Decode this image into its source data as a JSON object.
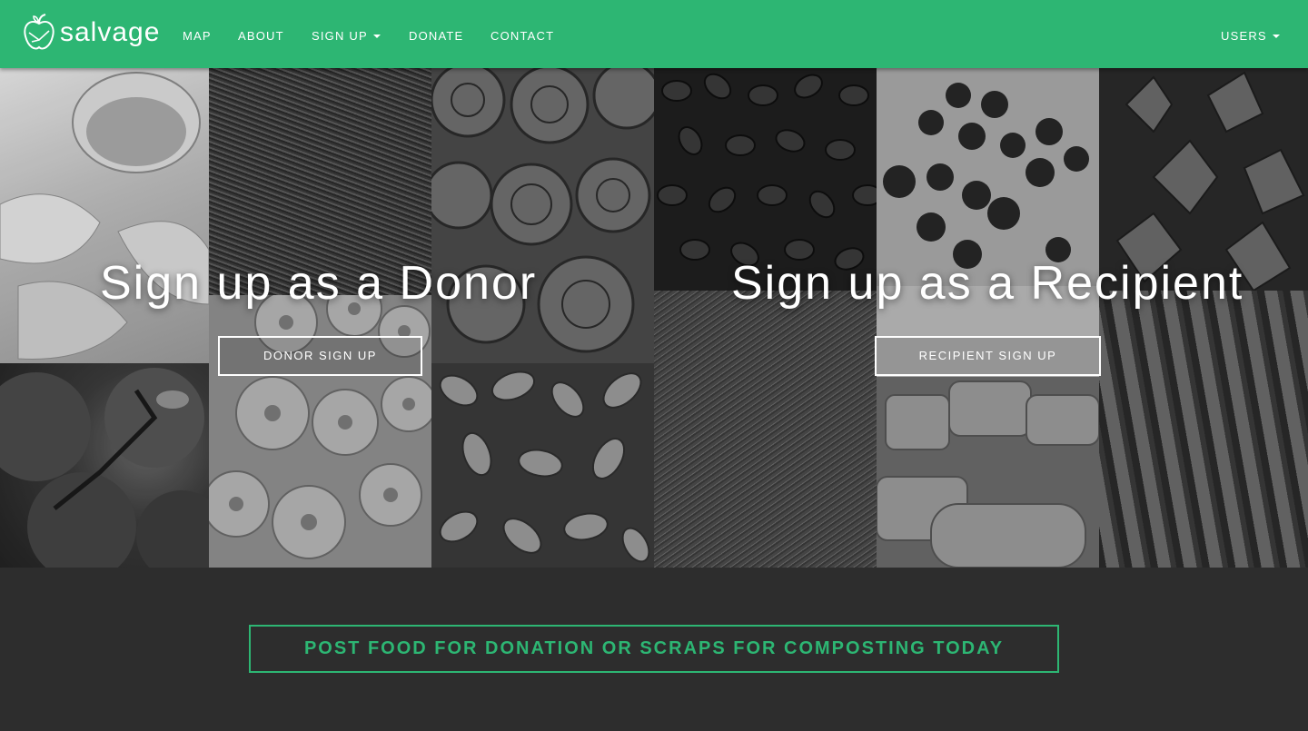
{
  "brand": {
    "name": "salvage"
  },
  "nav": {
    "items": [
      {
        "label": "MAP"
      },
      {
        "label": "ABOUT"
      },
      {
        "label": "SIGN UP"
      },
      {
        "label": "DONATE"
      },
      {
        "label": "CONTACT"
      }
    ],
    "users_label": "USERS"
  },
  "hero": {
    "donor": {
      "heading": "Sign up as a Donor",
      "button": "DONOR SIGN UP"
    },
    "recipient": {
      "heading": "Sign up as a Recipient",
      "button": "RECIPIENT SIGN UP"
    }
  },
  "cta": {
    "label": "POST FOOD FOR DONATION OR SCRAPS FOR COMPOSTING TODAY"
  },
  "colors": {
    "accent": "#2db673",
    "background": "#2d2d2d",
    "text_on_accent": "#ffffff"
  }
}
